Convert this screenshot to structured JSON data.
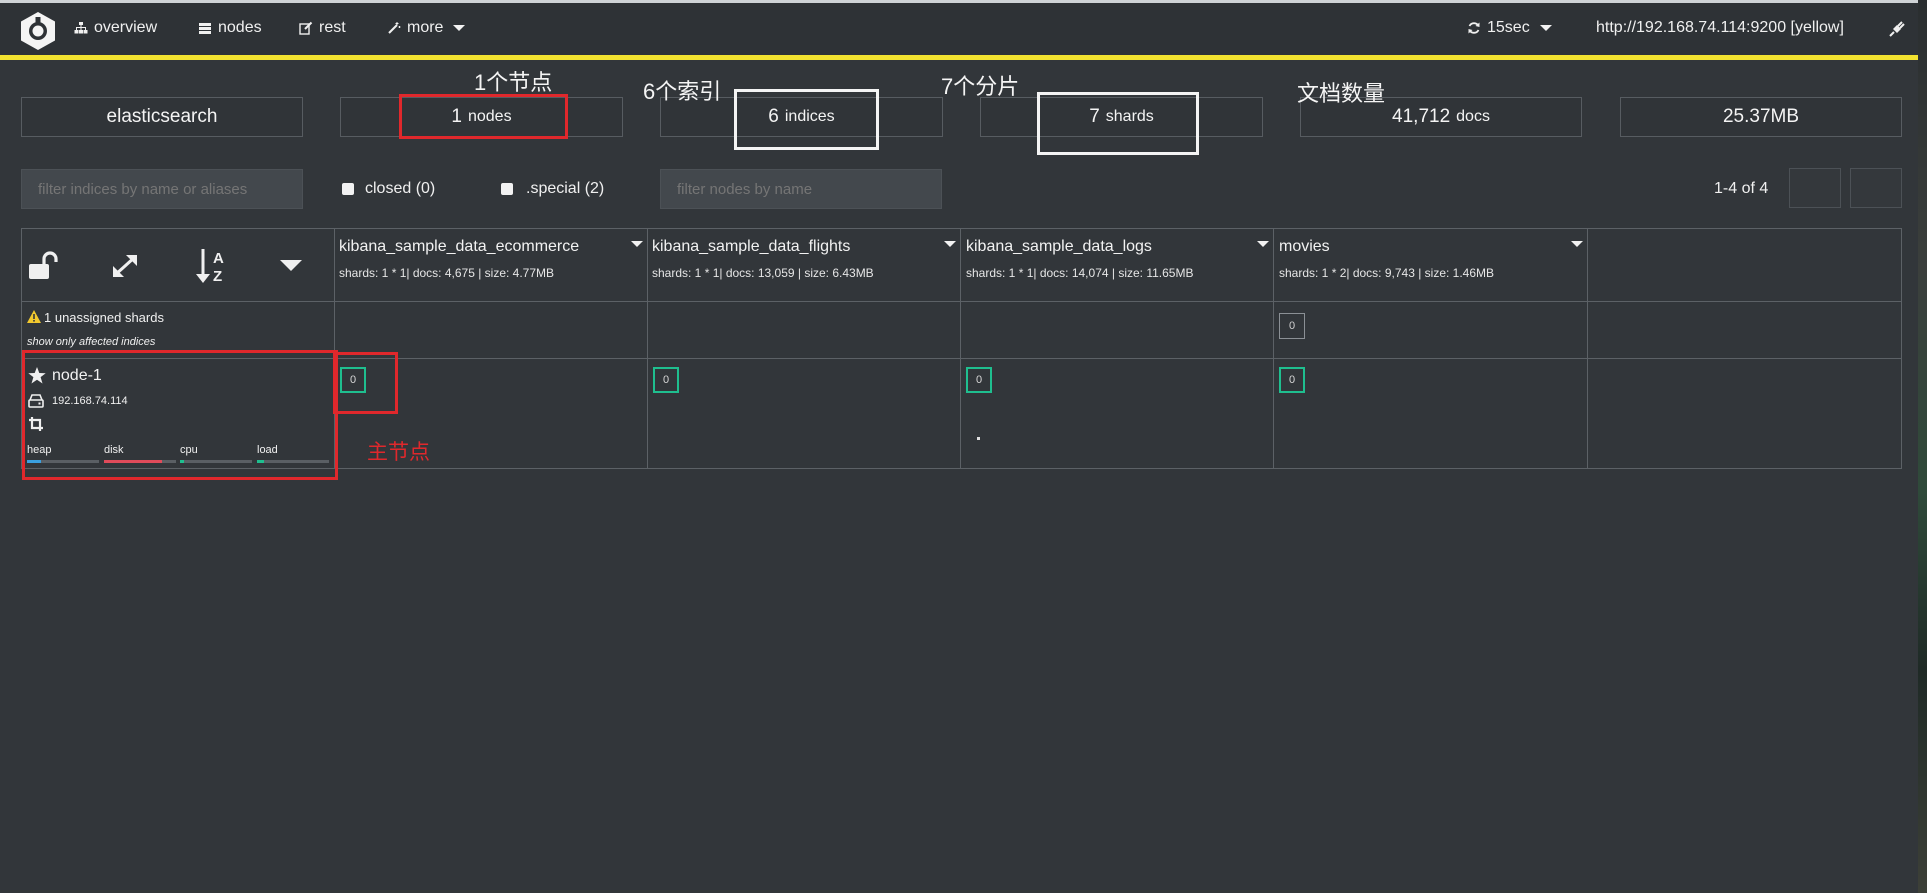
{
  "nav": {
    "overview": "overview",
    "nodes": "nodes",
    "rest": "rest",
    "more": "more",
    "refresh": "15sec",
    "cluster_url": "http://192.168.74.114:9200 [yellow]"
  },
  "stats": {
    "cluster_name": "elasticsearch",
    "nodes_num": "1",
    "nodes_label": "nodes",
    "indices_num": "6",
    "indices_label": "indices",
    "shards_num": "7",
    "shards_label": "shards",
    "docs_num": "41,712",
    "docs_label": "docs",
    "size": "25.37MB"
  },
  "annotations": {
    "nodes": "1个节点",
    "indices": "6个索引",
    "shards": "7个分片",
    "docs": "文档数量",
    "master": "主节点"
  },
  "filters": {
    "indices_placeholder": "filter indices by name or aliases",
    "closed_label": "closed (0)",
    "special_label": ".special (2)",
    "nodes_placeholder": "filter nodes by name",
    "pagination": "1-4 of 4"
  },
  "indices": [
    {
      "name": "kibana_sample_data_ecommerce",
      "info": "shards: 1 * 1| docs: 4,675 | size: 4.77MB",
      "shard": "0"
    },
    {
      "name": "kibana_sample_data_flights",
      "info": "shards: 1 * 1| docs: 13,059 | size: 6.43MB",
      "shard": "0"
    },
    {
      "name": "kibana_sample_data_logs",
      "info": "shards: 1 * 1| docs: 14,074 | size: 11.65MB",
      "shard": "0"
    },
    {
      "name": "movies",
      "info": "shards: 1 * 2| docs: 9,743 | size: 1.46MB",
      "shard": "0",
      "unassigned_shard": "0"
    }
  ],
  "unassigned": {
    "label": "1 unassigned shards",
    "link": "show only affected indices"
  },
  "node": {
    "name": "node-1",
    "ip": "192.168.74.114",
    "metrics": [
      {
        "label": "heap",
        "level": 0.2,
        "color": "#3aa0e0"
      },
      {
        "label": "disk",
        "level": 0.8,
        "color": "#e04b5a"
      },
      {
        "label": "cpu",
        "level": 0.05,
        "color": "#1fbf8f"
      },
      {
        "label": "load",
        "level": 0.1,
        "color": "#1fbf8f"
      }
    ]
  },
  "colors": {
    "yellow_status": "#f2e230",
    "annotation_red": "#e0282c",
    "shard_green": "#1fbf8f"
  }
}
